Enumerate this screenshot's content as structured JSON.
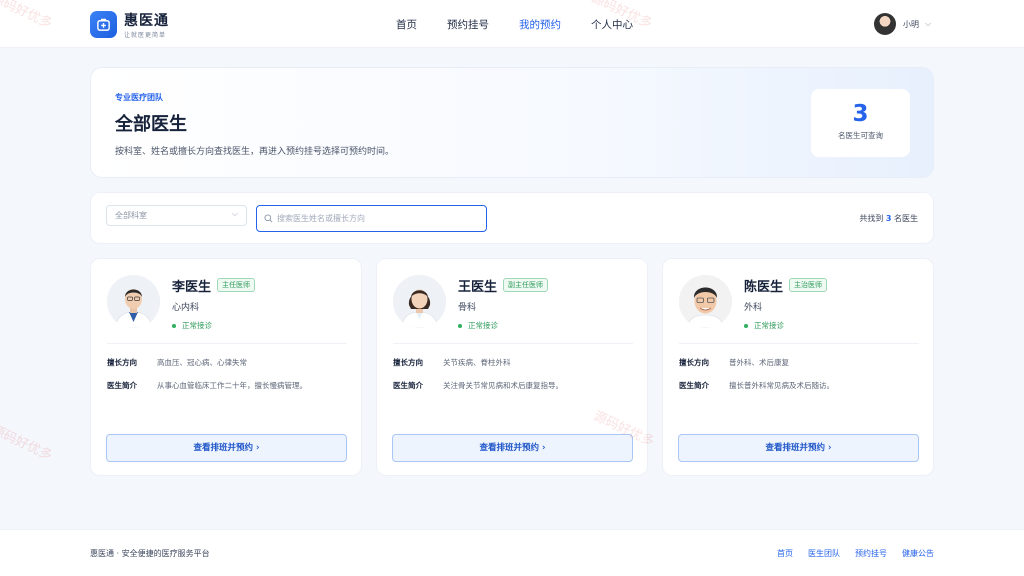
{
  "brand": {
    "name": "惠医通",
    "tagline": "让就医更简单"
  },
  "nav": {
    "items": [
      "首页",
      "预约挂号",
      "我的预约",
      "个人中心"
    ],
    "active_index": 2
  },
  "user": {
    "name": "小明"
  },
  "hero": {
    "tag": "专业医疗团队",
    "title": "全部医生",
    "description": "按科室、姓名或擅长方向查找医生，再进入预约挂号选择可预约时间。",
    "stat_value": "3",
    "stat_label": "名医生可查询"
  },
  "filter": {
    "department_value": "全部科室",
    "search_placeholder": "搜索医生姓名或擅长方向",
    "result_prefix": "共找到",
    "result_count": "3",
    "result_suffix": "名医生"
  },
  "labels": {
    "specialty": "擅长方向",
    "bio": "医生简介",
    "book_button": "查看排班并预约 ›"
  },
  "doctors": [
    {
      "name": "李医生",
      "title": "主任医师",
      "department": "心内科",
      "status": "正常接诊",
      "specialty": "高血压、冠心病、心律失常",
      "bio": "从事心血管临床工作二十年，擅长慢病管理。"
    },
    {
      "name": "王医生",
      "title": "副主任医师",
      "department": "骨科",
      "status": "正常接诊",
      "specialty": "关节疾病、脊柱外科",
      "bio": "关注骨关节常见病和术后康复指导。"
    },
    {
      "name": "陈医生",
      "title": "主治医师",
      "department": "外科",
      "status": "正常接诊",
      "specialty": "普外科、术后康复",
      "bio": "擅长普外科常见病及术后随访。"
    }
  ],
  "footer": {
    "text": "惠医通 · 安全便捷的医疗服务平台",
    "links": [
      "首页",
      "医生团队",
      "预约挂号",
      "健康公告"
    ]
  },
  "watermark": "源码好优多",
  "colors": {
    "accent": "#2563eb",
    "status_green": "#2eb05e",
    "background": "#f4f7fc"
  }
}
